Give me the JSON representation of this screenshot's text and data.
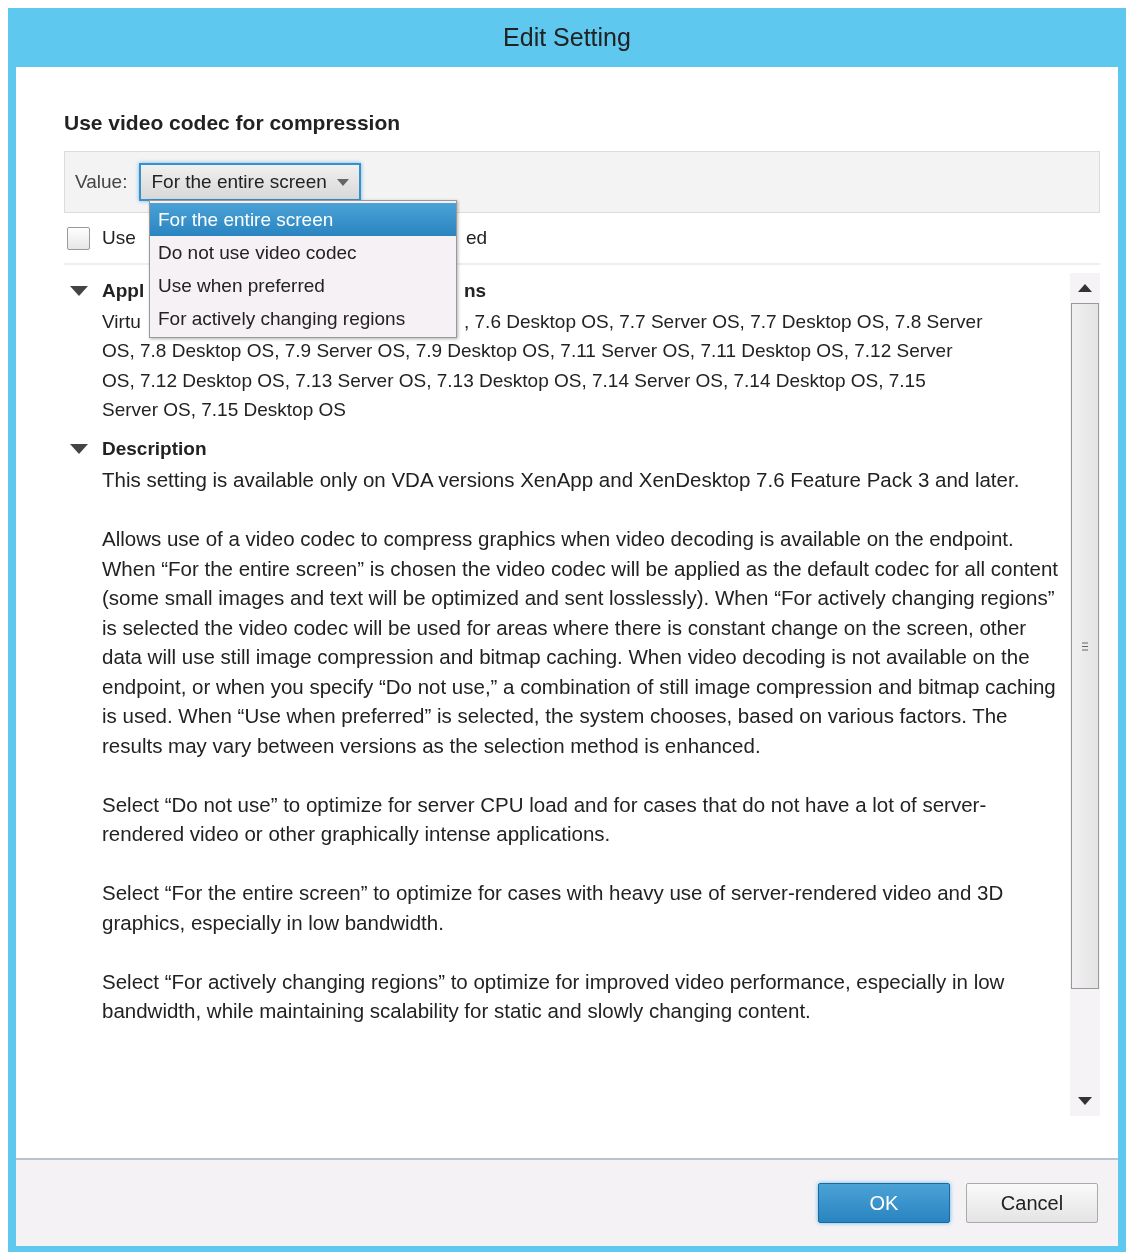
{
  "window": {
    "title": "Edit Setting"
  },
  "setting": {
    "heading": "Use video codec for compression"
  },
  "value": {
    "label": "Value:",
    "selected_text": "For the entire screen",
    "expanded": true,
    "options": [
      {
        "label": "For the entire screen",
        "selected": true
      },
      {
        "label": "Do not use video codec",
        "selected": false
      },
      {
        "label": "Use when preferred",
        "selected": false
      },
      {
        "label": "For actively changing regions",
        "selected": false
      }
    ]
  },
  "checkbox": {
    "checked": false,
    "label_fragments": [
      "Use",
      "ed"
    ]
  },
  "sections": [
    {
      "expanded": true,
      "heading_fragments": [
        "Appl",
        "ns"
      ],
      "lines": [
        [
          "Virtu",
          ", 7.6 Desktop OS, 7.7 Server OS, 7.7 Desktop OS, 7.8 Server"
        ],
        [
          "OS, 7.8 Desktop OS, 7.9 Server OS, 7.9 Desktop OS, 7.11 Server OS, 7.11 Desktop OS, 7.12 Server"
        ],
        [
          "OS, 7.12 Desktop OS, 7.13 Server OS, 7.13 Desktop OS, 7.14 Server OS, 7.14 Desktop OS, 7.15"
        ],
        [
          "Server OS, 7.15 Desktop OS"
        ]
      ]
    },
    {
      "expanded": true,
      "heading_fragments": [
        "Description"
      ],
      "paragraphs": [
        "This setting is available only on VDA versions XenApp and XenDesktop 7.6 Feature Pack 3 and later.",
        "Allows use of a video codec to compress graphics when video decoding is available on the endpoint. When “For the entire screen” is chosen the video codec will be applied as the default codec for all content (some small images and text will be optimized and sent losslessly). When “For actively changing regions” is selected the video codec will be used for areas where there is constant change on the screen, other data will use still image compression and bitmap caching. When video decoding is not available on the endpoint, or when you specify “Do not use,” a combination of still image compression and bitmap caching is used. When “Use when preferred” is selected, the system chooses, based on various factors. The results may vary between versions as the selection method is enhanced.",
        "Select “Do not use” to optimize for server CPU load and for cases that do not have a lot of server-rendered video or other graphically intense applications.",
        "Select “For the entire screen” to optimize for cases with heavy use of server-rendered video and 3D graphics, especially in low bandwidth.",
        "Select “For actively changing regions” to optimize for improved video performance, especially in low bandwidth, while maintaining scalability for static and slowly changing content."
      ]
    }
  ],
  "buttons": [
    {
      "label": "OK",
      "kind": "primary"
    },
    {
      "label": "Cancel",
      "kind": "secondary"
    }
  ]
}
